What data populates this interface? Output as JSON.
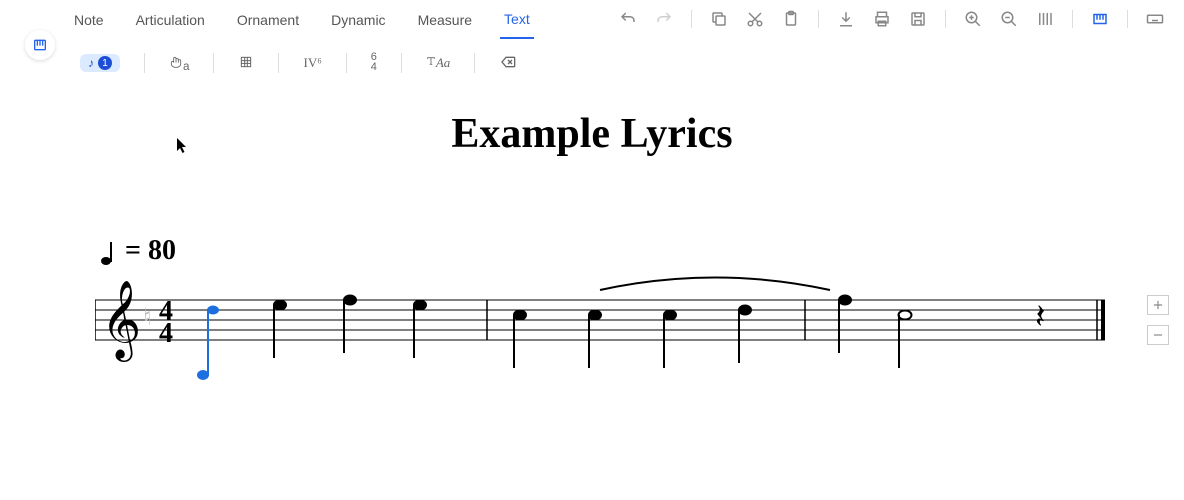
{
  "tabs": {
    "note": "Note",
    "articulation": "Articulation",
    "ornament": "Ornament",
    "dynamic": "Dynamic",
    "measure": "Measure",
    "text": "Text"
  },
  "sub_toolbar": {
    "lyric_badge": "1",
    "chord_fingering": "♫a",
    "chord_diagram": "▦",
    "roman": "IV⁶",
    "figured_top": "6",
    "figured_bottom": "4",
    "custom_text": "Aa",
    "delete": "⌫"
  },
  "score": {
    "title": "Example Lyrics",
    "tempo_value": "= 80",
    "time_sig_top": "4",
    "time_sig_bottom": "4"
  },
  "icons": {
    "piano": "▥"
  },
  "side": {
    "add": "+",
    "remove": "−"
  }
}
